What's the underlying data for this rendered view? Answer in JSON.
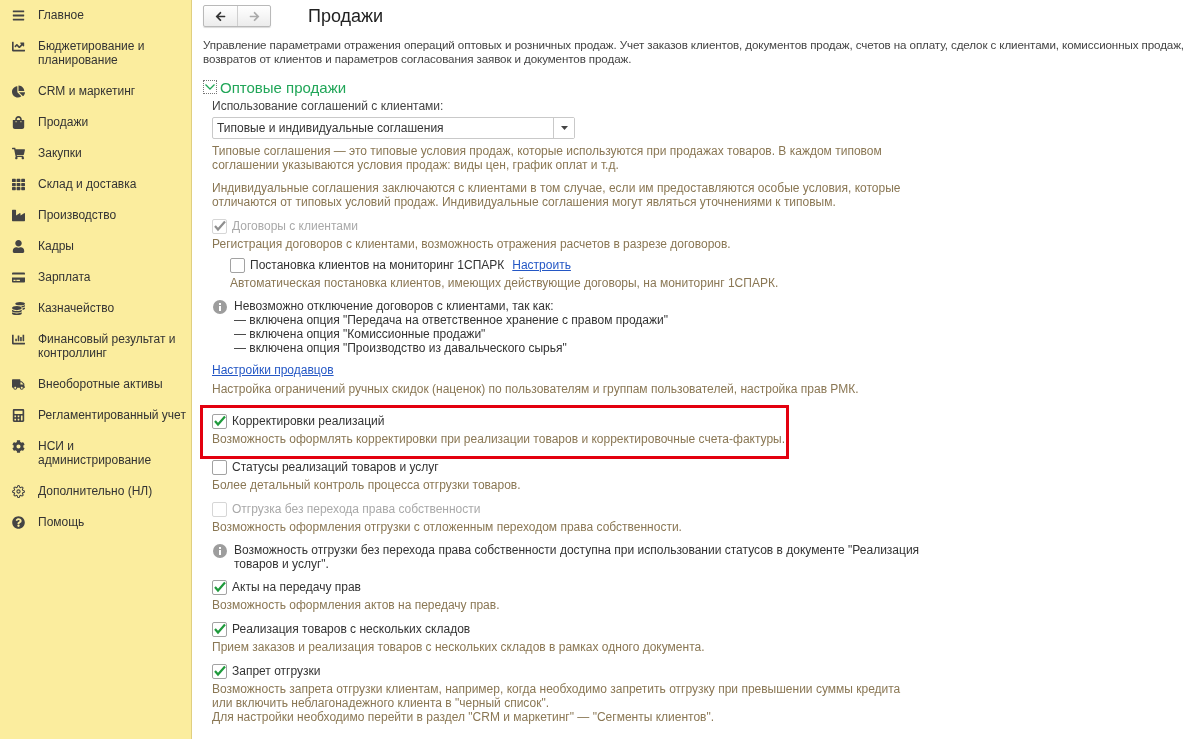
{
  "sidebar": {
    "items": [
      {
        "label": "Главное",
        "selected": false
      },
      {
        "label": "Бюджетирование и планирование",
        "selected": false
      },
      {
        "label": "CRM и маркетинг",
        "selected": false
      },
      {
        "label": "Продажи",
        "selected": false
      },
      {
        "label": "Закупки",
        "selected": false
      },
      {
        "label": "Склад и доставка",
        "selected": false
      },
      {
        "label": "Производство",
        "selected": false
      },
      {
        "label": "Кадры",
        "selected": false
      },
      {
        "label": "Зарплата",
        "selected": false
      },
      {
        "label": "Казначейство",
        "selected": false
      },
      {
        "label": "Финансовый результат и контроллинг",
        "selected": false
      },
      {
        "label": "Внеоборотные активы",
        "selected": false
      },
      {
        "label": "Регламентированный учет",
        "selected": false
      },
      {
        "label": "НСИ и администрирование",
        "selected": false
      },
      {
        "label": "Дополнительно (НЛ)",
        "selected": false
      },
      {
        "label": "Помощь",
        "selected": false
      }
    ]
  },
  "nav": {
    "back_disabled": false,
    "forward_disabled": true
  },
  "title": "Продажи",
  "intro": [
    "Управление параметрами отражения операций оптовых и розничных продаж. Учет заказов клиентов, документов продаж, счетов на оплату, сделок с клиентами, комиссионных продаж,",
    "возвратов от клиентов и параметров согласования заявок и документов продаж."
  ],
  "section": {
    "title": "Оптовые продажи",
    "expanded": true,
    "items": [
      {
        "kind": "label",
        "text": "Использование соглашений с клиентами:"
      },
      {
        "kind": "select",
        "value": "Типовые и индивидуальные соглашения"
      },
      {
        "kind": "hint",
        "lines": [
          "Типовые соглашения — это типовые условия продаж, которые используются при продажах товаров. В каждом типовом",
          "соглашении указываются условия продаж: виды цен, график оплат и т.д."
        ]
      },
      {
        "kind": "hint",
        "lines": [
          "Индивидуальные соглашения заключаются с клиентами в том случае, если им предоставляются особые условия, которые",
          "отличаются от типовых условий продаж. Индивидуальные соглашения могут являться уточнениями к типовым."
        ]
      },
      {
        "kind": "checkbox",
        "label": "Договоры с клиентами",
        "checked": true,
        "disabled": true,
        "highlighted": false,
        "hint": [
          "Регистрация договоров с клиентами, возможность отражения расчетов в разрезе договоров."
        ],
        "children": [
          {
            "kind": "checkbox",
            "label": "Постановка клиентов на мониторинг 1СПАРК",
            "checked": false,
            "disabled": false,
            "highlighted": false,
            "link": "Настроить",
            "hint": [
              "Автоматическая постановка клиентов, имеющих действующие договоры, на мониторинг 1СПАРК."
            ]
          }
        ]
      },
      {
        "kind": "info",
        "lines": [
          "Невозможно отключение договоров с клиентами, так как:",
          "— включена опция \"Передача на ответственное хранение с правом продажи\"",
          "— включена опция \"Комиссионные продажи\"",
          "— включена опция \"Производство из давальческого сырья\""
        ]
      },
      {
        "kind": "link",
        "text": "Настройки продавцов",
        "hint": [
          "Настройка ограничений ручных скидок (наценок) по пользователям и группам пользователей, настройка прав РМК."
        ]
      },
      {
        "kind": "checkbox",
        "label": "Корректировки реализаций",
        "checked": true,
        "disabled": false,
        "highlighted": true,
        "hint": [
          "Возможность оформлять корректировки при реализации товаров и корректировочные счета-фактуры."
        ]
      },
      {
        "kind": "checkbox",
        "label": "Статусы реализаций товаров и услуг",
        "checked": false,
        "disabled": false,
        "highlighted": false,
        "hint": [
          "Более детальный контроль процесса отгрузки товаров."
        ]
      },
      {
        "kind": "checkbox",
        "label": "Отгрузка без перехода права собственности",
        "checked": false,
        "disabled": true,
        "highlighted": false,
        "hint": [
          "Возможность оформления отгрузки с отложенным переходом права собственности."
        ]
      },
      {
        "kind": "info",
        "lines": [
          "Возможность отгрузки без перехода права собственности доступна при использовании статусов в документе \"Реализация",
          "товаров и услуг\"."
        ]
      },
      {
        "kind": "checkbox",
        "label": "Акты на передачу прав",
        "checked": true,
        "disabled": false,
        "highlighted": false,
        "hint": [
          "Возможность оформления актов на передачу прав."
        ]
      },
      {
        "kind": "checkbox",
        "label": "Реализация товаров с нескольких складов",
        "checked": true,
        "disabled": false,
        "highlighted": false,
        "hint": [
          "Прием заказов и реализация товаров с нескольких складов в рамках одного документа."
        ]
      },
      {
        "kind": "checkbox",
        "label": "Запрет отгрузки",
        "checked": true,
        "disabled": false,
        "highlighted": false,
        "hint": [
          "Возможность запрета отгрузки клиентам, например, когда необходимо запретить отгрузку при превышении суммы кредита",
          "или включить неблагонадежного клиента в \"черный список\".",
          "Для настройки необходимо перейти в раздел \"CRM и маркетинг\" — \"Сегменты клиентов\"."
        ]
      }
    ]
  }
}
